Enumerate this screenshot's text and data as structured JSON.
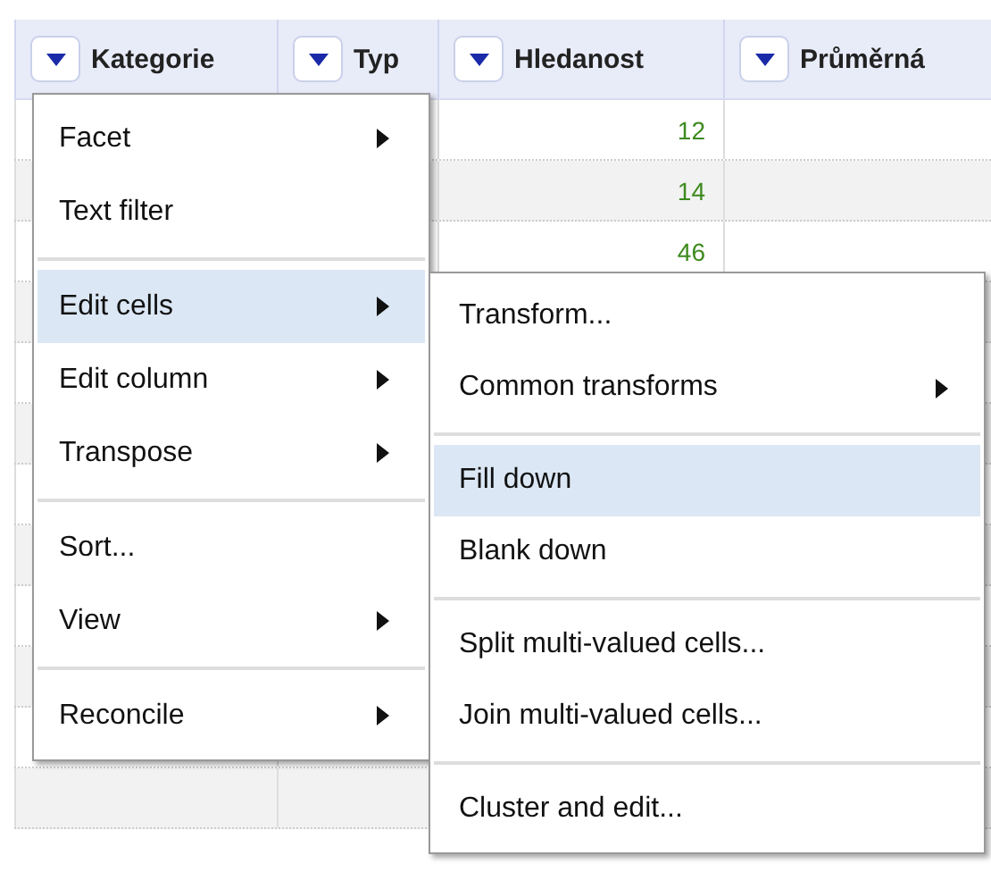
{
  "columns": [
    {
      "label": "Kategorie"
    },
    {
      "label": "Typ"
    },
    {
      "label": "Hledanost"
    },
    {
      "label": "Průměrná"
    }
  ],
  "rows": [
    {
      "hledanost": "12"
    },
    {
      "hledanost": "14"
    },
    {
      "hledanost": "46"
    }
  ],
  "menu": [
    {
      "kind": "item",
      "label": "Facet",
      "submenu": true,
      "selected": false
    },
    {
      "kind": "item",
      "label": "Text filter",
      "submenu": false,
      "selected": false
    },
    {
      "kind": "separator"
    },
    {
      "kind": "item",
      "label": "Edit cells",
      "submenu": true,
      "selected": true
    },
    {
      "kind": "item",
      "label": "Edit column",
      "submenu": true,
      "selected": false
    },
    {
      "kind": "item",
      "label": "Transpose",
      "submenu": true,
      "selected": false
    },
    {
      "kind": "separator"
    },
    {
      "kind": "item",
      "label": "Sort...",
      "submenu": false,
      "selected": false
    },
    {
      "kind": "item",
      "label": "View",
      "submenu": true,
      "selected": false
    },
    {
      "kind": "separator"
    },
    {
      "kind": "item",
      "label": "Reconcile",
      "submenu": true,
      "selected": false
    }
  ],
  "submenu": [
    {
      "kind": "item",
      "label": "Transform...",
      "submenu": false,
      "selected": false
    },
    {
      "kind": "item",
      "label": "Common transforms",
      "submenu": true,
      "selected": false
    },
    {
      "kind": "separator"
    },
    {
      "kind": "item",
      "label": "Fill down",
      "submenu": false,
      "selected": true
    },
    {
      "kind": "item",
      "label": "Blank down",
      "submenu": false,
      "selected": false
    },
    {
      "kind": "separator"
    },
    {
      "kind": "item",
      "label": "Split multi-valued cells...",
      "submenu": false,
      "selected": false
    },
    {
      "kind": "item",
      "label": "Join multi-valued cells...",
      "submenu": false,
      "selected": false
    },
    {
      "kind": "separator"
    },
    {
      "kind": "item",
      "label": "Cluster and edit...",
      "submenu": false,
      "selected": false
    }
  ]
}
